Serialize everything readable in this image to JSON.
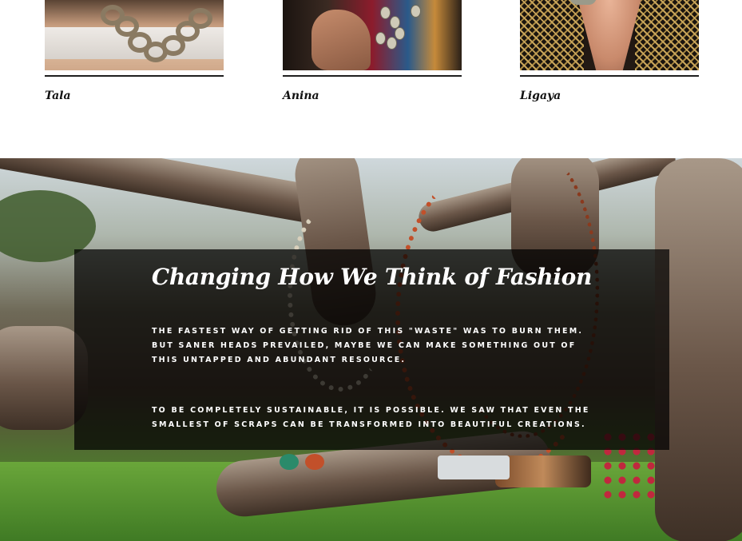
{
  "products": [
    {
      "name": "Tala"
    },
    {
      "name": "Anina"
    },
    {
      "name": "Ligaya"
    }
  ],
  "hero": {
    "title": "Changing How We Think of Fashion",
    "paragraph_1": "The fastest way of getting rid of this \"waste\" was to burn them. But saner heads prevailed, maybe we can make something out of this untapped and abundant resource.",
    "paragraph_2": "To be completely sustainable, it is possible. We saw that even the smallest of scraps can be transformed into beautiful creations."
  }
}
